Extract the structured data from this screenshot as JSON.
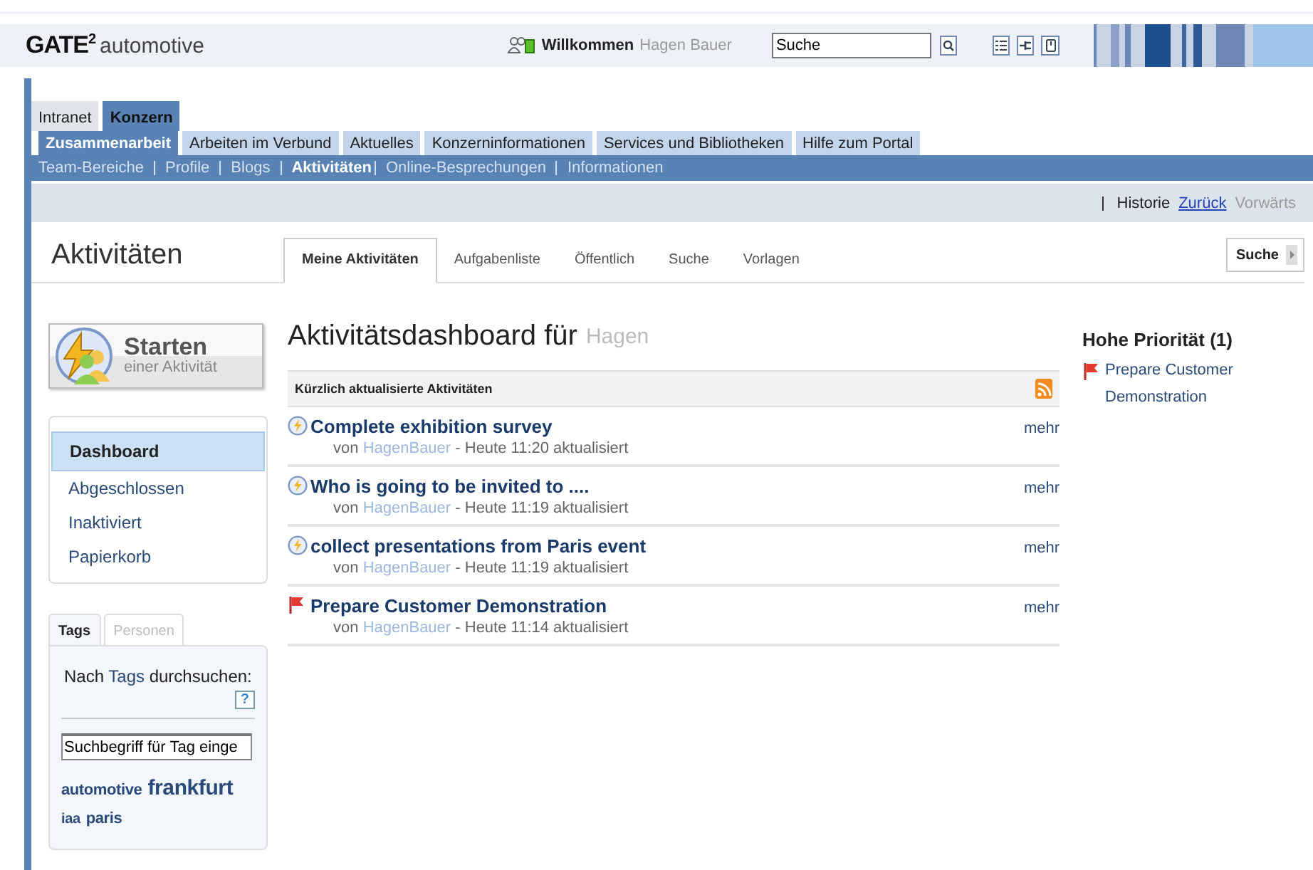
{
  "header": {
    "logo": "GATE",
    "logo_sup": "2",
    "logo_sub": "automotive",
    "welcome": "Willkommen",
    "user": "Hagen Bauer",
    "search": {
      "value": "Suche"
    }
  },
  "top_tabs": [
    {
      "label": "Intranet",
      "selected": false
    },
    {
      "label": "Konzern",
      "selected": true
    }
  ],
  "sub_tabs": [
    {
      "label": "Zusammenarbeit",
      "selected": true
    },
    {
      "label": "Arbeiten im Verbund",
      "selected": false
    },
    {
      "label": "Aktuelles",
      "selected": false
    },
    {
      "label": "Konzerninformationen",
      "selected": false
    },
    {
      "label": "Services und Bibliotheken",
      "selected": false
    },
    {
      "label": "Hilfe zum Portal",
      "selected": false
    }
  ],
  "links": [
    {
      "label": "Team-Bereiche",
      "selected": false
    },
    {
      "label": "Profile",
      "selected": false
    },
    {
      "label": "Blogs",
      "selected": false
    },
    {
      "label": "Aktivitäten",
      "selected": true
    },
    {
      "label": "Online-Besprechungen",
      "selected": false
    },
    {
      "label": "Informationen",
      "selected": false
    }
  ],
  "history": {
    "label": "Historie",
    "back": {
      "label": "Zurück",
      "disabled": false
    },
    "forward": {
      "label": "Vorwärts",
      "disabled": true
    }
  },
  "page": {
    "title": "Aktivitäten",
    "tabs": [
      {
        "label": "Meine Aktivitäten",
        "selected": true
      },
      {
        "label": "Aufgabenliste",
        "selected": false
      },
      {
        "label": "Öffentlich",
        "selected": false
      },
      {
        "label": "Suche",
        "selected": false
      },
      {
        "label": "Vorlagen",
        "selected": false
      }
    ],
    "search_button": "Suche"
  },
  "start_button": {
    "title": "Starten",
    "subtitle": "einer Aktivität"
  },
  "nav": [
    {
      "label": "Dashboard",
      "selected": true
    },
    {
      "label": "Abgeschlossen",
      "selected": false
    },
    {
      "label": "Inaktiviert",
      "selected": false
    },
    {
      "label": "Papierkorb",
      "selected": false
    }
  ],
  "tag_panel": {
    "tabs": [
      {
        "label": "Tags",
        "selected": true
      },
      {
        "label": "Personen",
        "selected": false
      }
    ],
    "prompt": "Nach",
    "prompt_link": "Tags",
    "prompt_after": "durchsuchen:",
    "help": "?",
    "input": {
      "value": "Suchbegriff für Tag einge"
    },
    "tags": [
      {
        "label": "automotive",
        "kind": "medium"
      },
      {
        "label": "frankfurt",
        "kind": "large"
      },
      {
        "label": "iaa",
        "kind": "small"
      },
      {
        "label": "paris",
        "kind": "medium"
      }
    ]
  },
  "dashboard": {
    "title": "Aktivitätsdashboard für",
    "user": "Hagen",
    "section": "Kürzlich aktualisierte Aktivitäten",
    "activities": [
      {
        "kind": "activity",
        "title": "Complete exhibition survey",
        "by": "von",
        "author": "HagenBauer",
        "time": "- Heute 11:20 aktualisiert",
        "more": "mehr"
      },
      {
        "kind": "activity",
        "title": "Who is going to be invited to ....",
        "by": "von",
        "author": "HagenBauer",
        "time": "- Heute 11:19 aktualisiert",
        "more": "mehr"
      },
      {
        "kind": "activity",
        "title": "collect presentations from Paris event",
        "by": "von",
        "author": "HagenBauer",
        "time": "- Heute 11:19 aktualisiert",
        "more": "mehr"
      },
      {
        "kind": "priority",
        "title": "Prepare Customer Demonstration",
        "by": "von",
        "author": "HagenBauer",
        "time": "- Heute 11:14 aktualisiert",
        "more": "mehr"
      }
    ]
  },
  "priority": {
    "title": "Hohe Priorität (1)",
    "items": [
      "Prepare Customer Demonstration"
    ]
  }
}
